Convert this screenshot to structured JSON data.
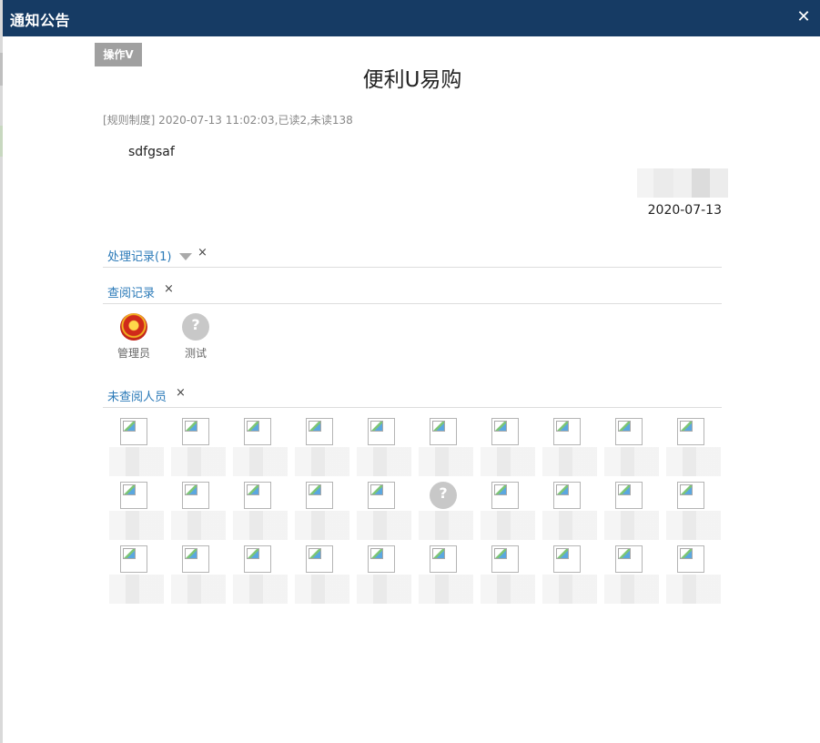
{
  "window": {
    "title": "通知公告",
    "close_icon": "close-icon"
  },
  "toolbar": {
    "operate_label": "操作V"
  },
  "notice": {
    "title": "便利U易购",
    "meta": "[规则制度] 2020-07-13 11:02:03,已读2,未读138",
    "body": "sdfgsaf",
    "sign_date": "2020-07-13"
  },
  "sections": {
    "process": {
      "label": "处理记录(1)",
      "close": "×"
    },
    "read": {
      "label": "查阅记录",
      "close": "×"
    },
    "unread": {
      "label": "未查阅人员",
      "close": "×"
    }
  },
  "readers": [
    {
      "name": "管理员",
      "avatar": "emblem-avatar-icon"
    },
    {
      "name": "测试",
      "avatar": "default-avatar-icon"
    }
  ],
  "unread_grid": {
    "rows": 3,
    "columns": 10,
    "default_avatar_position": {
      "row": 2,
      "column": 6
    }
  }
}
